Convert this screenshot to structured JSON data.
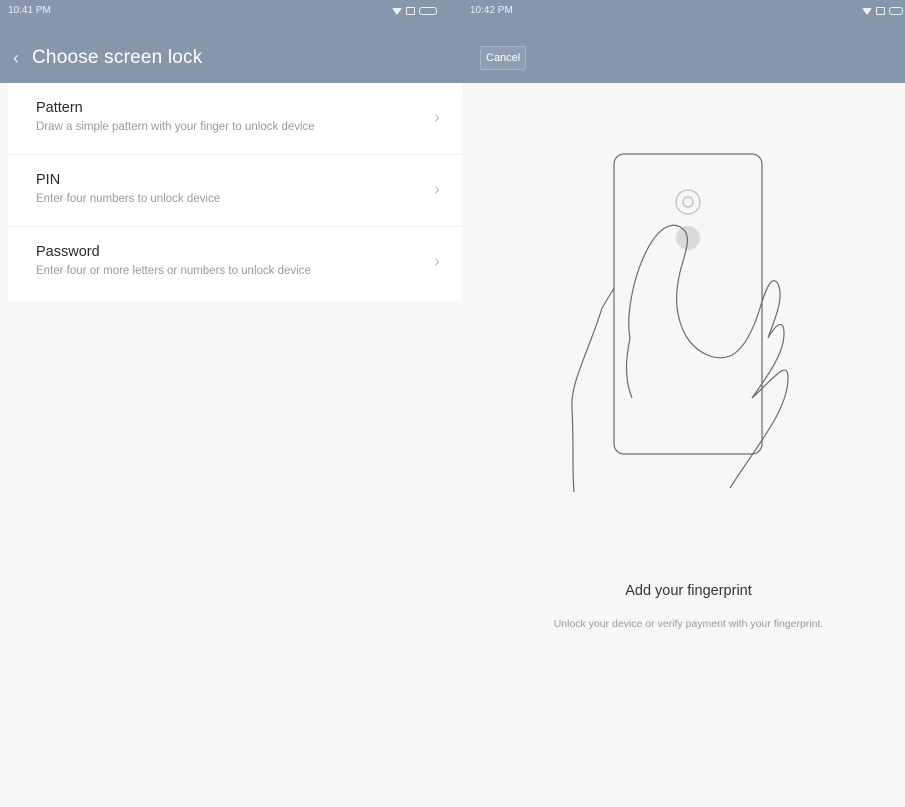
{
  "left": {
    "status": {
      "time": "10:41 PM"
    },
    "title": "Choose screen lock",
    "items": [
      {
        "title": "Pattern",
        "subtitle": "Draw a simple pattern with your finger to unlock device"
      },
      {
        "title": "PIN",
        "subtitle": "Enter four numbers to unlock device"
      },
      {
        "title": "Password",
        "subtitle": "Enter four or more letters or numbers to unlock device"
      }
    ]
  },
  "right": {
    "status": {
      "time": "10:42 PM"
    },
    "cancel_label": "Cancel",
    "heading": "Add your fingerprint",
    "description": "Unlock your device or verify payment with your fingerprint."
  },
  "icons": [
    "back-arrow-icon",
    "wifi-icon",
    "sim-icon",
    "battery-icon",
    "chevron-right-icon",
    "phone-hand-illustration"
  ],
  "colors": {
    "header": "#8696ab",
    "background": "#f7f7f7"
  }
}
